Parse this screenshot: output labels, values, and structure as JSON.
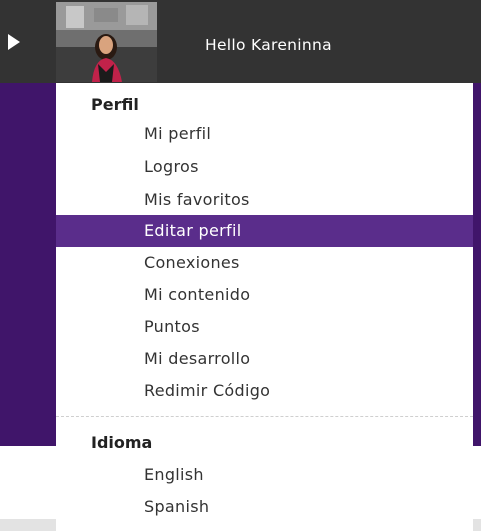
{
  "header": {
    "greeting": "Hello Kareninna",
    "avatar_icon": "user-photo-icon",
    "expand_icon": "chevron-left-icon"
  },
  "menu": {
    "profile_section": {
      "title": "Perfil",
      "items": [
        {
          "label": "Mi perfil",
          "active": false
        },
        {
          "label": "Logros",
          "active": false
        },
        {
          "label": "Mis favoritos",
          "active": false
        },
        {
          "label": "Editar perfil",
          "active": true
        },
        {
          "label": "Conexiones",
          "active": false
        },
        {
          "label": "Mi contenido",
          "active": false
        },
        {
          "label": "Puntos",
          "active": false
        },
        {
          "label": "Mi desarrollo",
          "active": false
        },
        {
          "label": "Redimir Código",
          "active": false
        }
      ]
    },
    "language_section": {
      "title": "Idioma",
      "items": [
        {
          "label": "English"
        },
        {
          "label": "Spanish"
        }
      ]
    }
  },
  "colors": {
    "header_bg": "#333333",
    "page_purple": "#40156a",
    "active_item": "#5a2d8b",
    "text": "#333333"
  }
}
